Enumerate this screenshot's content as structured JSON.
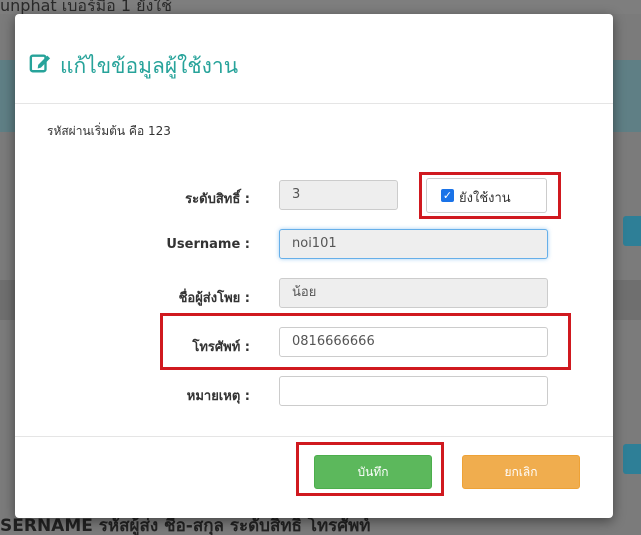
{
  "background": {
    "row_top": "unphat    เบอร์มือ    1                    ยังใช้",
    "col_header_bottom": "SERNAME       รหัสผู้ส่ง    ชื่อ-สกุล    ระดับสิทธิ์       โทรศัพท์"
  },
  "modal": {
    "title": "แก้ไขข้อมูลผู้ใช้งาน",
    "hint": "รหัสผ่านเริ่มต้น คือ 123",
    "fields": {
      "level_label": "ระดับสิทธิ์ :",
      "level_value": "3",
      "active_label": "ยังใช้งาน",
      "username_label": "Username :",
      "username_value": "noi101",
      "sender_label": "ชื่อผู้ส่งโพย :",
      "sender_value": "น้อย",
      "phone_label": "โทรศัพท์ :",
      "phone_value": "0816666666",
      "note_label": "หมายเหตุ :",
      "note_value": ""
    },
    "buttons": {
      "save": "บันทึก",
      "cancel": "ยกเลิก"
    }
  },
  "colors": {
    "title": "#27a39a",
    "save": "#5cb85c",
    "cancel": "#f0ad4e",
    "highlight": "#d0191f"
  }
}
